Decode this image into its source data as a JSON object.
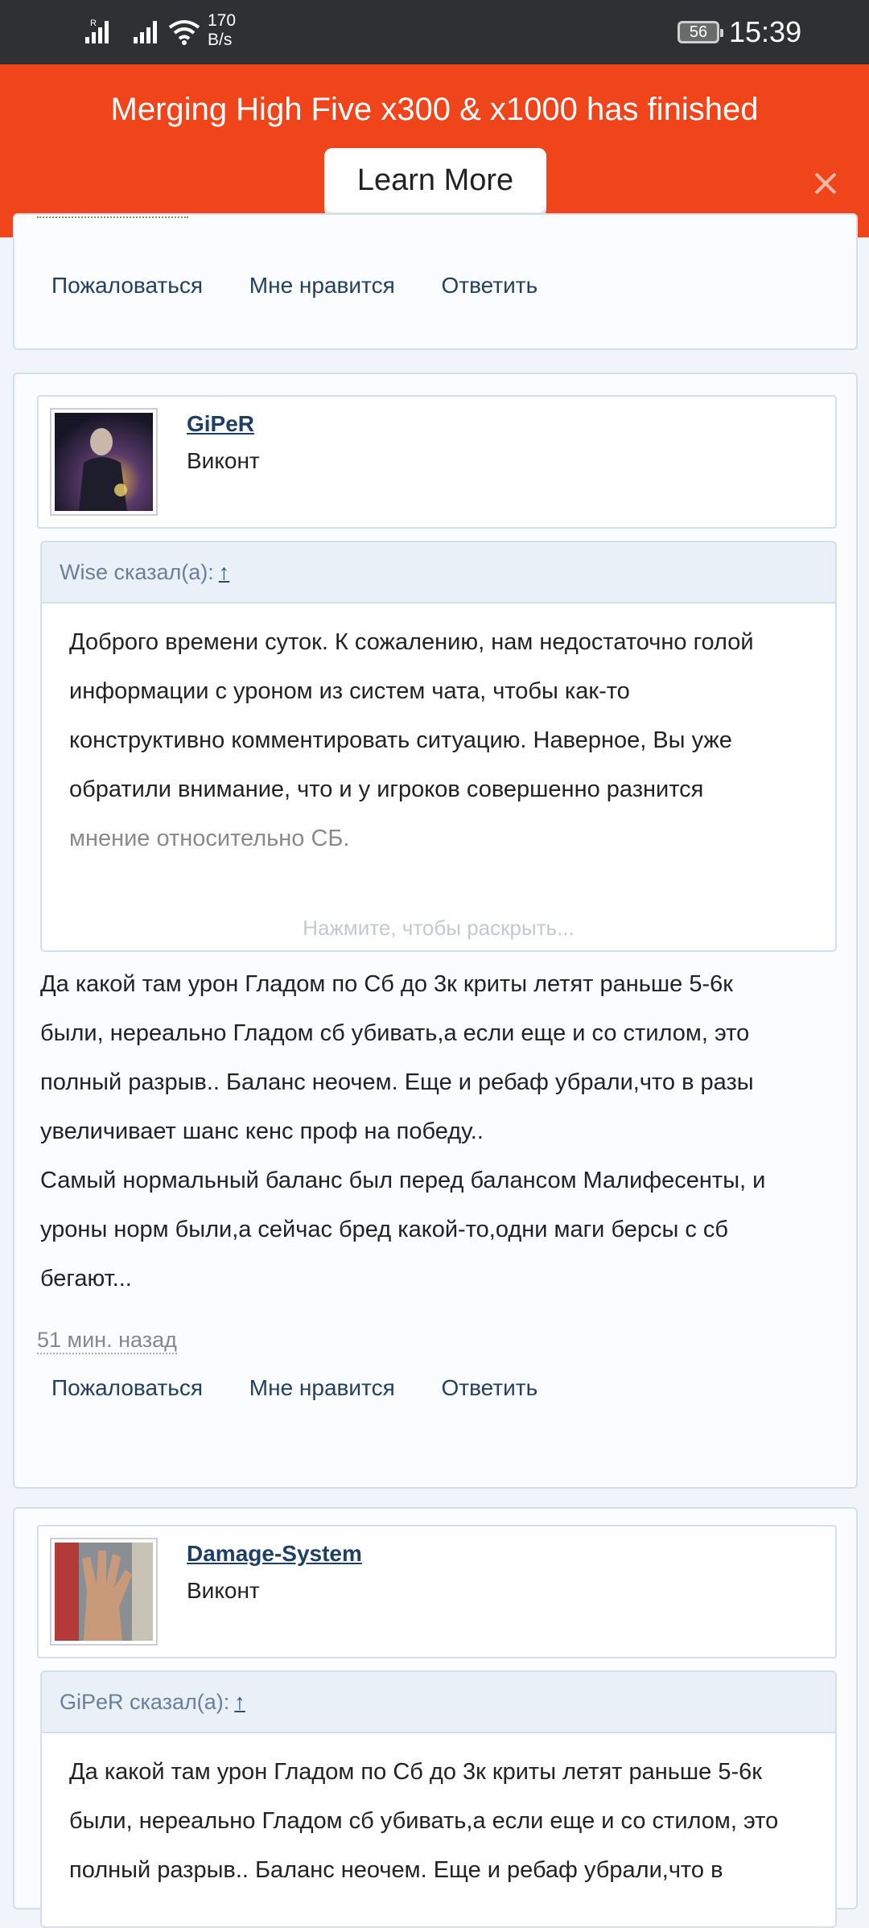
{
  "status": {
    "speed_value": "170",
    "speed_unit": "B/s",
    "battery": "56",
    "time": "15:39",
    "sim1_label": "R",
    "icons": [
      "signal-icon",
      "signal-icon",
      "wifi-icon",
      "battery-icon"
    ]
  },
  "banner": {
    "text": "Merging High Five x300 & x1000 has finished",
    "button_label": "Learn More",
    "bg_color": "#f0441b",
    "close_icon": "close-icon"
  },
  "actions": {
    "report": "Пожаловаться",
    "like": "Мне нравится",
    "reply": "Ответить"
  },
  "posts": [
    {
      "username": "GiPeR",
      "rank": "Виконт",
      "quote": {
        "author": "Wise сказал(а):",
        "arrow": "↑",
        "lines": [
          "Доброго времени суток. К сожалению, нам недостаточно голой",
          "информации с уроном из систем чата, чтобы как-то",
          "конструктивно комментировать ситуацию. Наверное, Вы уже",
          "обратили внимание, что и у игроков совершенно разнится",
          "мнение относительно СБ."
        ],
        "expand": "Нажмите, чтобы раскрыть..."
      },
      "message_lines": [
        "Да какой там урон Гладом по Сб до 3к криты летят раньше 5-6к",
        "были, нереально Гладом сб убивать,а если еще и со стилом, это",
        "полный разрыв.. Баланс неочем. Еще и ребаф убрали,что в разы",
        "увеличивает шанс кенс проф на победу..",
        "Самый нормальный баланс был перед балансом Малифесенты, и",
        "уроны норм были,а сейчас бред какой-то,одни маги берсы с сб",
        "бегают..."
      ],
      "time": "51 мин. назад"
    },
    {
      "username": "Damage-System",
      "rank": "Виконт",
      "quote": {
        "author": "GiPeR сказал(а):",
        "arrow": "↑",
        "lines": [
          "Да какой там урон Гладом по Сб до 3к криты летят раньше 5-6к",
          "были, нереально Гладом сб убивать,а если еще и со стилом, это",
          "полный разрыв.. Баланс неочем. Еще и ребаф убрали,что в"
        ]
      }
    }
  ]
}
